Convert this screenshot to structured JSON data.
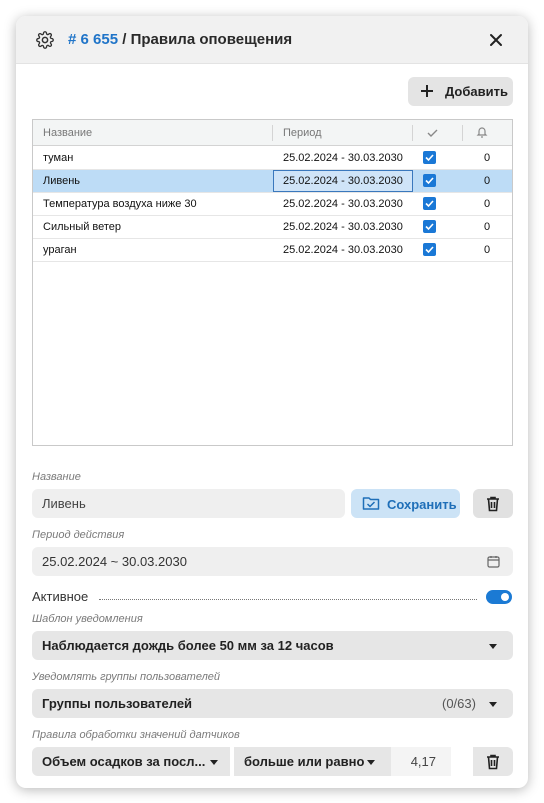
{
  "header": {
    "id": "# 6 655",
    "separator": " / ",
    "title": "Правила оповещения"
  },
  "toolbar": {
    "add_label": "Добавить"
  },
  "table": {
    "columns": [
      "Название",
      "Период"
    ],
    "rows": [
      {
        "name": "туман",
        "period": "25.02.2024 - 30.03.2030",
        "checked": true,
        "count": "0"
      },
      {
        "name": "Ливень",
        "period": "25.02.2024 - 30.03.2030",
        "checked": true,
        "count": "0",
        "selected": true
      },
      {
        "name": "Температура воздуха ниже 30",
        "period": "25.02.2024 - 30.03.2030",
        "checked": true,
        "count": "0"
      },
      {
        "name": "Сильный ветер",
        "period": "25.02.2024 - 30.03.2030",
        "checked": true,
        "count": "0"
      },
      {
        "name": "ураган",
        "period": "25.02.2024 - 30.03.2030",
        "checked": true,
        "count": "0"
      }
    ]
  },
  "form": {
    "name_label": "Название",
    "name_value": "Ливень",
    "save_label": "Сохранить",
    "period_label": "Период действия",
    "period_value": "25.02.2024 ~ 30.03.2030",
    "active_label": "Активное",
    "active": true,
    "template_label": "Шаблон уведомления",
    "template_value": "Наблюдается дождь более 50 мм за 12 часов",
    "groups_label": "Уведомлять группы пользователей",
    "groups_value": "Группы пользователей",
    "groups_count": "(0/63)",
    "rules_label": "Правила обработки значений датчиков",
    "rule_param": "Объем осадков за посл...",
    "rule_op": "больше или равно",
    "rule_value": "4,17"
  },
  "colors": {
    "accent": "#1f74c8",
    "selected_row": "#bddcf6",
    "toggle_on": "#1b7ad4"
  }
}
